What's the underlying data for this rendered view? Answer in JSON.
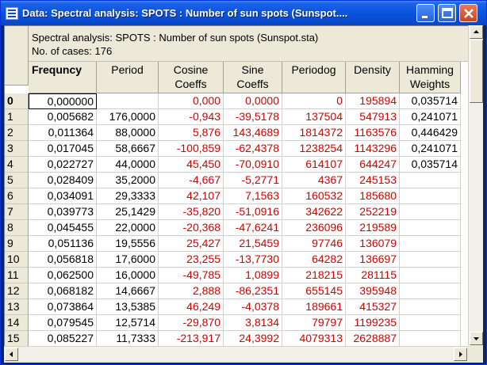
{
  "window": {
    "title": "Data: Spectral analysis: SPOTS : Number of sun spots (Sunspot....",
    "controls": [
      "minimize",
      "maximize",
      "close"
    ]
  },
  "info": {
    "line1": "Spectral analysis: SPOTS : Number of sun spots (Sunspot.sta)",
    "line2": "No. of cases: 176"
  },
  "columns": [
    {
      "key": "freq",
      "label": "Frequncy",
      "bold": true
    },
    {
      "key": "per",
      "label": "Period"
    },
    {
      "key": "cos",
      "label": "Cosine\nCoeffs"
    },
    {
      "key": "sin",
      "label": "Sine\nCoeffs"
    },
    {
      "key": "pg",
      "label": "Periodog"
    },
    {
      "key": "den",
      "label": "Density"
    },
    {
      "key": "ham",
      "label": "Hamming\nWeights"
    }
  ],
  "rows": [
    {
      "n": "0",
      "freq": "0,000000",
      "per": "",
      "cos": "0,000",
      "sin": "0,0000",
      "pg": "0",
      "den": "195894",
      "ham": "0,035714"
    },
    {
      "n": "1",
      "freq": "0,005682",
      "per": "176,0000",
      "cos": "-0,943",
      "sin": "-39,5178",
      "pg": "137504",
      "den": "547913",
      "ham": "0,241071"
    },
    {
      "n": "2",
      "freq": "0,011364",
      "per": "88,0000",
      "cos": "5,876",
      "sin": "143,4689",
      "pg": "1814372",
      "den": "1163576",
      "ham": "0,446429"
    },
    {
      "n": "3",
      "freq": "0,017045",
      "per": "58,6667",
      "cos": "-100,859",
      "sin": "-62,4378",
      "pg": "1238254",
      "den": "1143296",
      "ham": "0,241071"
    },
    {
      "n": "4",
      "freq": "0,022727",
      "per": "44,0000",
      "cos": "45,450",
      "sin": "-70,0910",
      "pg": "614107",
      "den": "644247",
      "ham": "0,035714"
    },
    {
      "n": "5",
      "freq": "0,028409",
      "per": "35,2000",
      "cos": "-4,667",
      "sin": "-5,2771",
      "pg": "4367",
      "den": "245153",
      "ham": ""
    },
    {
      "n": "6",
      "freq": "0,034091",
      "per": "29,3333",
      "cos": "42,107",
      "sin": "7,1563",
      "pg": "160532",
      "den": "185680",
      "ham": ""
    },
    {
      "n": "7",
      "freq": "0,039773",
      "per": "25,1429",
      "cos": "-35,820",
      "sin": "-51,0916",
      "pg": "342622",
      "den": "252219",
      "ham": ""
    },
    {
      "n": "8",
      "freq": "0,045455",
      "per": "22,0000",
      "cos": "-20,368",
      "sin": "-47,6241",
      "pg": "236096",
      "den": "219589",
      "ham": ""
    },
    {
      "n": "9",
      "freq": "0,051136",
      "per": "19,5556",
      "cos": "25,427",
      "sin": "21,5459",
      "pg": "97746",
      "den": "136079",
      "ham": ""
    },
    {
      "n": "10",
      "freq": "0,056818",
      "per": "17,6000",
      "cos": "23,255",
      "sin": "-13,7730",
      "pg": "64282",
      "den": "136697",
      "ham": ""
    },
    {
      "n": "11",
      "freq": "0,062500",
      "per": "16,0000",
      "cos": "-49,785",
      "sin": "1,0899",
      "pg": "218215",
      "den": "281115",
      "ham": ""
    },
    {
      "n": "12",
      "freq": "0,068182",
      "per": "14,6667",
      "cos": "2,888",
      "sin": "-86,2351",
      "pg": "655145",
      "den": "395948",
      "ham": ""
    },
    {
      "n": "13",
      "freq": "0,073864",
      "per": "13,5385",
      "cos": "46,249",
      "sin": "-4,0378",
      "pg": "189661",
      "den": "415327",
      "ham": ""
    },
    {
      "n": "14",
      "freq": "0,079545",
      "per": "12,5714",
      "cos": "-29,870",
      "sin": "3,8134",
      "pg": "79797",
      "den": "1199235",
      "ham": ""
    },
    {
      "n": "15",
      "freq": "0,085227",
      "per": "11,7333",
      "cos": "-213,917",
      "sin": "24,3992",
      "pg": "4079313",
      "den": "2628887",
      "ham": ""
    }
  ],
  "red_columns": [
    "cos",
    "sin",
    "pg",
    "den"
  ],
  "colors": {
    "title_bar": "#0a55e0",
    "red_values": "#d40000"
  }
}
